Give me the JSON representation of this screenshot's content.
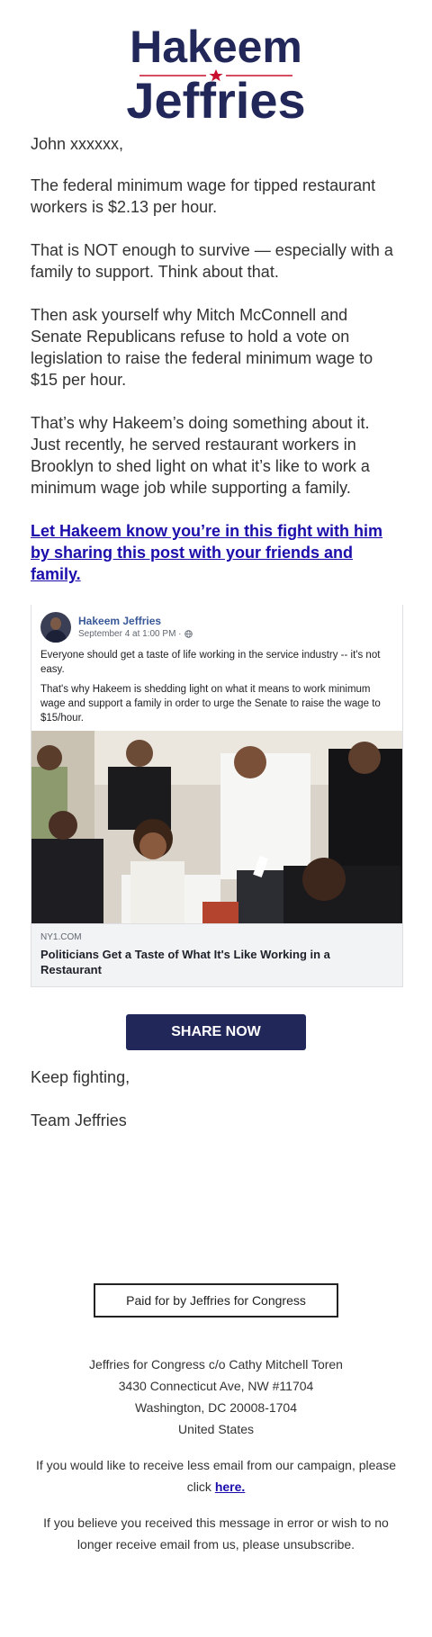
{
  "logo": {
    "top_word": "Hakeem",
    "bottom_word": "Jeffries",
    "brand_color": "#22275a",
    "star_color": "#c8102e",
    "icon": "star-icon"
  },
  "email": {
    "salutation": "John xxxxxx,",
    "paragraphs": [
      "The federal minimum wage for tipped restaurant workers is $2.13 per hour.",
      "That is NOT enough to survive — especially with a family to support. Think about that.",
      "Then ask yourself why Mitch McConnell and Senate Republicans refuse to hold a vote on legislation to raise the federal minimum wage to $15 per hour.",
      "That’s why Hakeem’s doing something about it. Just recently, he served restaurant workers in Brooklyn to shed light on what it’s like to work a minimum wage job while supporting a family."
    ],
    "cta_link": "Let Hakeem know you’re in this fight with him by sharing this post with your friends and family."
  },
  "facebook_post": {
    "author": "Hakeem Jeffries",
    "meta": "September 4 at 1:00 PM · ",
    "meta_icon": "globe-icon",
    "text_1": "Everyone should get a taste of life working in the service industry -- it's not easy.",
    "text_2": "That's why Hakeem is shedding light on what it means to work minimum wage and support a family in order to urge the Senate to raise the wage to $15/hour.",
    "link_domain": "NY1.COM",
    "link_title": "Politicians Get a Taste of What It's Like Working in a Restaurant"
  },
  "share_button": {
    "label": "SHARE NOW",
    "color": "#22275a"
  },
  "signoff": {
    "line_1": "Keep fighting,",
    "line_2": "Team Jeffries"
  },
  "footer": {
    "paid_for": "Paid for by Jeffries for Congress",
    "address": [
      "Jeffries for Congress c/o Cathy Mitchell Toren",
      "3430 Connecticut Ave, NW #11704",
      "Washington, DC 20008-1704",
      "United States"
    ],
    "less_email_text": "If you would like to receive less email from our campaign, please click ",
    "less_email_link": "here.",
    "unsubscribe_text": "If you believe you received this message in error or wish to no longer receive email from us, please unsubscribe."
  }
}
